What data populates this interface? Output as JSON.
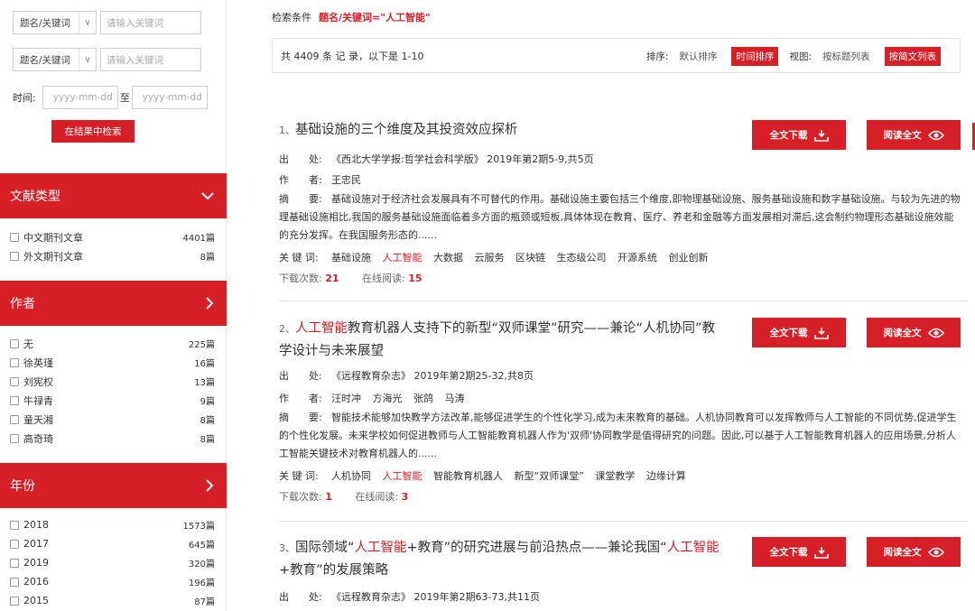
{
  "sidebar": {
    "search_rows": [
      {
        "field": "题名/关键词",
        "placeholder": "请输入关键词"
      },
      {
        "field": "题名/关键词",
        "placeholder": "请输入关键词"
      }
    ],
    "time_label": "时间:",
    "date_from_placeholder": "yyyy-mm-dd",
    "date_to_placeholder": "yyyy-mm-dd",
    "date_separator": "至",
    "refine_button": "在结果中检索",
    "facets": [
      {
        "title": "文献类型",
        "icon": "chevron-down-icon",
        "items": [
          {
            "name": "中文期刊文章",
            "count": "4401篇"
          },
          {
            "name": "外文期刊文章",
            "count": "8篇"
          }
        ]
      },
      {
        "title": "作者",
        "icon": "chevron-right-icon",
        "items": [
          {
            "name": "无",
            "count": "225篇"
          },
          {
            "name": "徐英瑾",
            "count": "16篇"
          },
          {
            "name": "刘宪权",
            "count": "13篇"
          },
          {
            "name": "牛禄青",
            "count": "9篇"
          },
          {
            "name": "童天湘",
            "count": "8篇"
          },
          {
            "name": "高奇琦",
            "count": "8篇"
          }
        ]
      },
      {
        "title": "年份",
        "icon": "chevron-right-icon",
        "items": [
          {
            "name": "2018",
            "count": "1573篇"
          },
          {
            "name": "2017",
            "count": "645篇"
          },
          {
            "name": "2019",
            "count": "320篇"
          },
          {
            "name": "2016",
            "count": "196篇"
          },
          {
            "name": "2015",
            "count": "87篇"
          }
        ]
      }
    ]
  },
  "main": {
    "criteria_label": "检索条件",
    "criteria_value": "题名/关键词=\"人工智能\"",
    "summary_text": "共 4409 条 记 录，以下是 1-10",
    "sort_label": "排序:",
    "sort_default": "默认排序",
    "sort_time": "时间排序",
    "view_label": "视图:",
    "view_title_list": "按标题列表",
    "view_abstract_list": "按简文列表",
    "download_label": "全文下载",
    "read_label": "阅读全文",
    "source_key": "出　　处:",
    "author_key": "作　　者:",
    "abstract_key": "摘　　要:",
    "keyword_key": "关 键 词:",
    "downloads_label": "下载次数:",
    "online_label": "在线阅读:",
    "results": [
      {
        "num": "1、",
        "title_parts": [
          {
            "text": "基础设施的三个维度及其投资效应探析",
            "hl": false
          }
        ],
        "source": "《西北大学学报:哲学社会科学版》 2019年第2期5-9,共5页",
        "authors": [
          "王忠民"
        ],
        "abstract": "基础设施对于经济社会发展具有不可替代的作用。基础设施主要包括三个维度,即物理基础设施、服务基础设施和数字基础设施。与较为先进的物理基础设施相比,我国的服务基础设施面临着多方面的瓶颈或短板,具体体现在教育、医疗、养老和金融等方面发展相对滞后,这会制约物理形态基础设施效能的充分发挥。在我国服务形态的......",
        "keywords": [
          {
            "text": "基础设施",
            "hl": false
          },
          {
            "text": "人工智能",
            "hl": true
          },
          {
            "text": "大数据",
            "hl": false
          },
          {
            "text": "云服务",
            "hl": false
          },
          {
            "text": "区块链",
            "hl": false
          },
          {
            "text": "生态级公司",
            "hl": false
          },
          {
            "text": "开源系统",
            "hl": false
          },
          {
            "text": "创业创新",
            "hl": false
          }
        ],
        "downloads": "21",
        "reads": "15"
      },
      {
        "num": "2、",
        "title_parts": [
          {
            "text": "人工智能",
            "hl": true
          },
          {
            "text": "教育机器人支持下的新型“双师课堂”研究——兼论“人机协同”教学设计与未来展望",
            "hl": false
          }
        ],
        "source": "《远程教育杂志》 2019年第2期25-32,共8页",
        "authors": [
          "汪时冲",
          "方海光",
          "张鸽",
          "马涛"
        ],
        "abstract": "智能技术能够加快教学方法改革,能够促进学生的个性化学习,成为未来教育的基础。人机协同教育可以发挥教师与人工智能的不同优势,促进学生的个性化发展。未来学校如何促进教师与人工智能教育机器人作为'双师'协同教学是值得研究的问题。因此,可以基于人工智能教育机器人的应用场景,分析人工智能关键技术对教育机器人的......",
        "keywords": [
          {
            "text": "人机协同",
            "hl": false
          },
          {
            "text": "人工智能",
            "hl": true
          },
          {
            "text": "智能教育机器人",
            "hl": false
          },
          {
            "text": "新型“双师课堂”",
            "hl": false
          },
          {
            "text": "课堂教学",
            "hl": false
          },
          {
            "text": "边缘计算",
            "hl": false
          }
        ],
        "downloads": "1",
        "reads": "3"
      },
      {
        "num": "3、",
        "title_parts": [
          {
            "text": "国际领域“",
            "hl": false
          },
          {
            "text": "人工智能",
            "hl": true
          },
          {
            "text": "+教育”的研究进展与前沿热点——兼论我国“",
            "hl": false
          },
          {
            "text": "人工智能",
            "hl": true
          },
          {
            "text": "+教育”的发展策略",
            "hl": false
          }
        ],
        "source": "《远程教育杂志》 2019年第2期63-73,共11页"
      }
    ]
  },
  "colors": {
    "accent": "#d71f27",
    "text": "#333333",
    "border": "#e3e3e3"
  }
}
